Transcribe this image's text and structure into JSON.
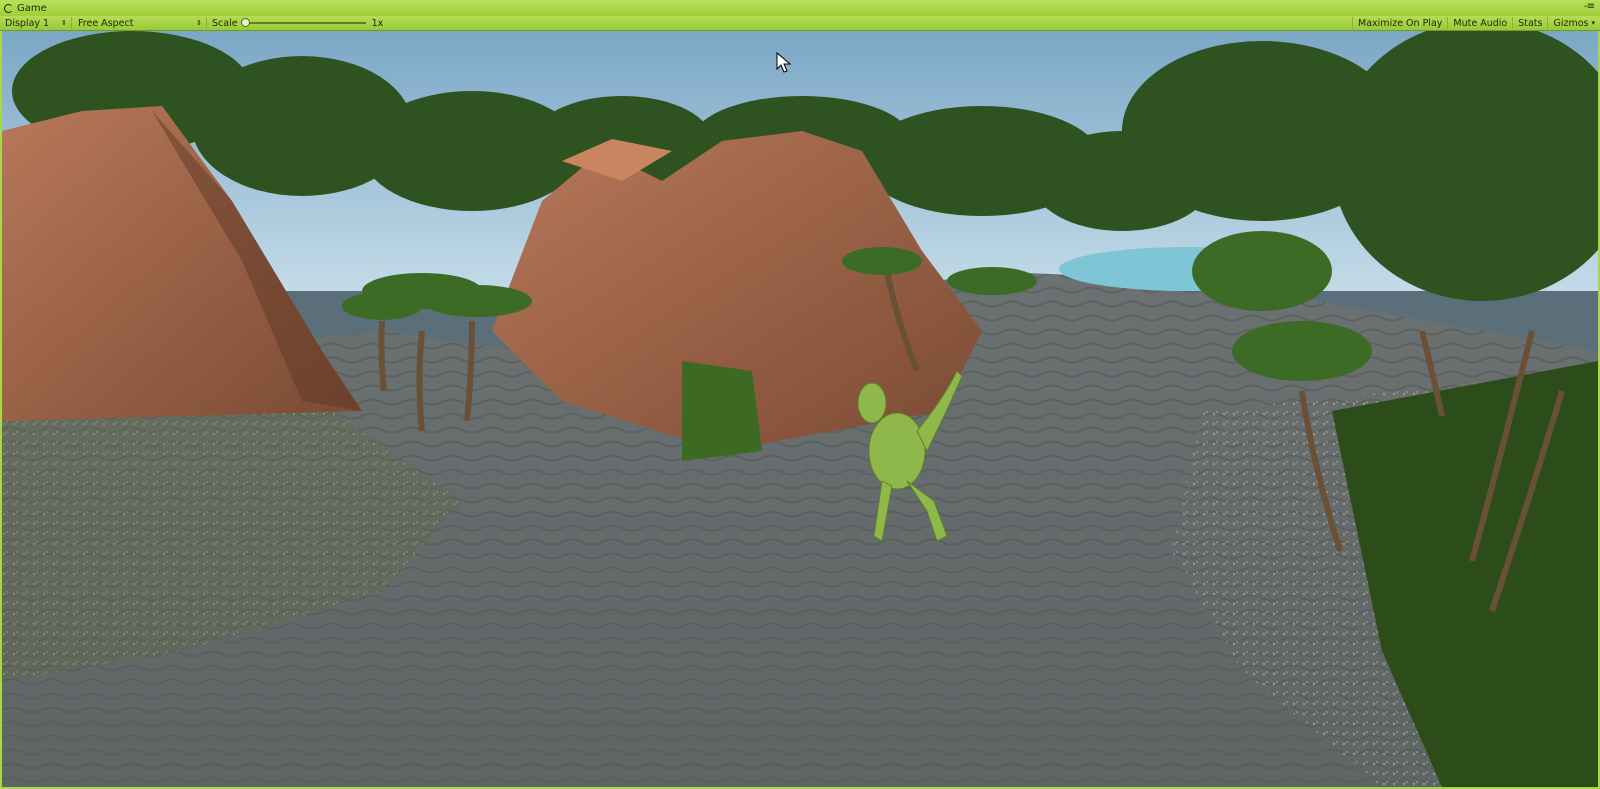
{
  "window": {
    "tab_title": "Game",
    "tab_icon": "unity-logo-icon",
    "menu_glyph": "-≡"
  },
  "toolbar": {
    "display_label": "Display 1",
    "aspect_label": "Free Aspect",
    "scale_label": "Scale",
    "scale_value_label": "1x",
    "scale_level": 1,
    "maximize_on_play_label": "Maximize On Play",
    "mute_audio_label": "Mute Audio",
    "stats_label": "Stats",
    "gizmos_label": "Gizmos"
  },
  "scene": {
    "description_icon": "game-viewport"
  },
  "colors": {
    "editor_tint": "#a8d848",
    "sky": "#9fc3dc",
    "water": "#7ec6d6",
    "sand": "#6f7576",
    "rock": "#a86a4a",
    "foliage": "#2f5a1e",
    "dino": "#8fb84a"
  }
}
